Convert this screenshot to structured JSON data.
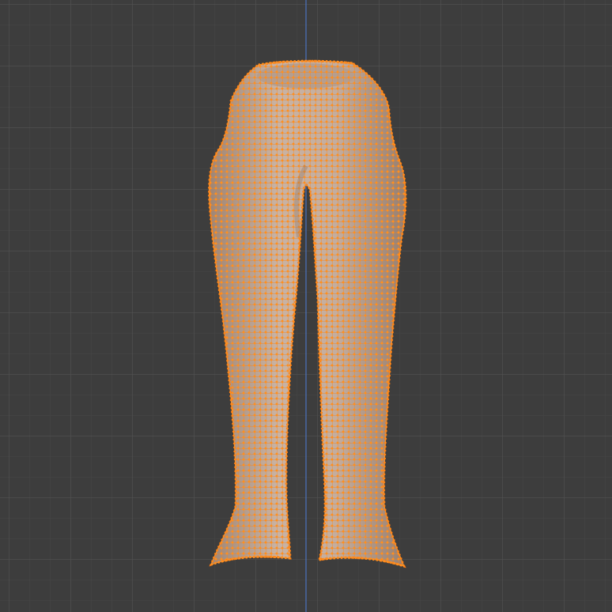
{
  "viewport": {
    "mode": "edit-mode",
    "object": "flared-pants-mesh",
    "selection": "all-vertices-selected"
  },
  "colors": {
    "background": "#3d3d3d",
    "grid_minor": "#474747",
    "grid_major": "#545454",
    "axis_y": "#4a6fb5",
    "mesh_fill": "#bfa898",
    "mesh_shade": "#9d8576",
    "wire": "#f0821f",
    "vertex": "#ff8f1f",
    "outline": "#ff7a10"
  }
}
